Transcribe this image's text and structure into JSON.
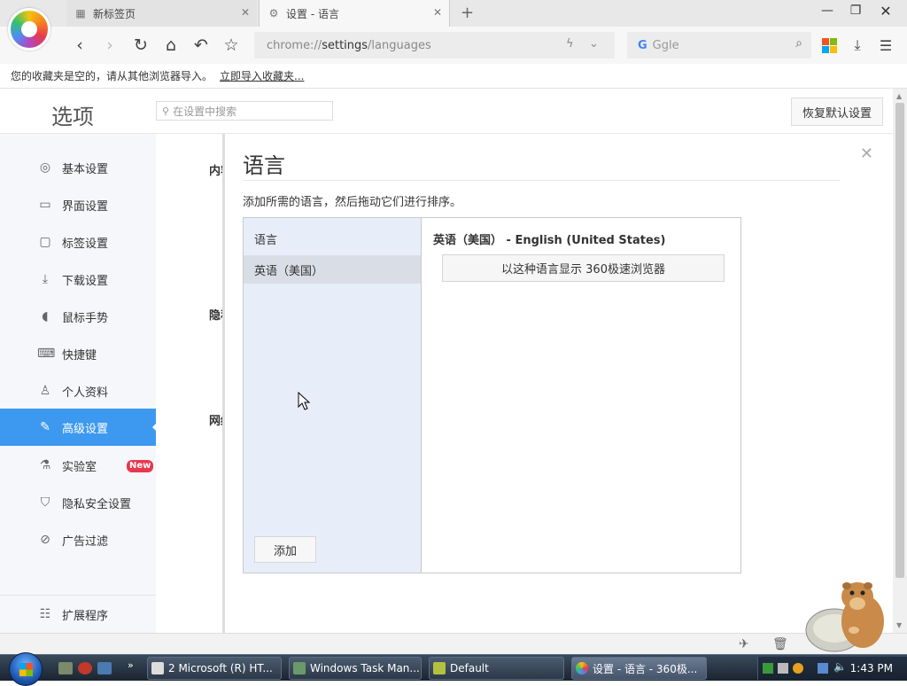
{
  "tabs": [
    {
      "label": "新标签页",
      "icon": "grid-page-icon"
    },
    {
      "label": "设置 - 语言",
      "icon": "gear-icon"
    }
  ],
  "toolbar": {
    "address_prefix": "chrome://",
    "address_host": "settings",
    "address_path": "/languages",
    "search_engine_label": "G",
    "search_text": "Ggle"
  },
  "bookmarks": {
    "message": "您的收藏夹是空的，请从其他浏览器导入。",
    "import_link": "立即导入收藏夹..."
  },
  "settings": {
    "title": "选项",
    "search_placeholder": "在设置中搜索",
    "restore_button": "恢复默认设置",
    "sidebar": [
      {
        "label": "基本设置",
        "icon": "gear-icon",
        "active": false
      },
      {
        "label": "界面设置",
        "icon": "window-icon",
        "active": false
      },
      {
        "label": "标签设置",
        "icon": "tab-icon",
        "active": false
      },
      {
        "label": "下载设置",
        "icon": "download-icon",
        "active": false
      },
      {
        "label": "鼠标手势",
        "icon": "mouse-icon",
        "active": false
      },
      {
        "label": "快捷键",
        "icon": "keyboard-icon",
        "active": false
      },
      {
        "label": "个人资料",
        "icon": "user-icon",
        "active": false
      },
      {
        "label": "高级设置",
        "icon": "wrench-icon",
        "active": true
      },
      {
        "label": "实验室",
        "icon": "flask-icon",
        "active": false,
        "badge": "New"
      },
      {
        "label": "隐私安全设置",
        "icon": "shield-icon",
        "active": false
      },
      {
        "label": "广告过滤",
        "icon": "block-icon",
        "active": false
      }
    ],
    "extensions": {
      "label": "扩展程序",
      "icon": "extension-icon"
    },
    "bg_sections": [
      "内容",
      "隐私",
      "网络"
    ]
  },
  "modal": {
    "title": "语言",
    "description": "添加所需的语言，然后拖动它们进行排序。",
    "list_header": "语言",
    "languages": [
      "英语（美国）"
    ],
    "selected_language_title": "英语（美国） - English (United States)",
    "display_button": "以这种语言显示 360极速浏览器",
    "add_button": "添加"
  },
  "taskbar": {
    "tasks": [
      {
        "label": "2 Microsoft (R) HT...",
        "active": false
      },
      {
        "label": "Windows Task Man...",
        "active": false
      },
      {
        "label": "Default",
        "active": false
      },
      {
        "label": "设置 - 语言 - 360极...",
        "active": true
      }
    ],
    "clock": "1:43 PM"
  },
  "colors": {
    "accent": "#3d98f0",
    "badge": "#e8384f"
  }
}
